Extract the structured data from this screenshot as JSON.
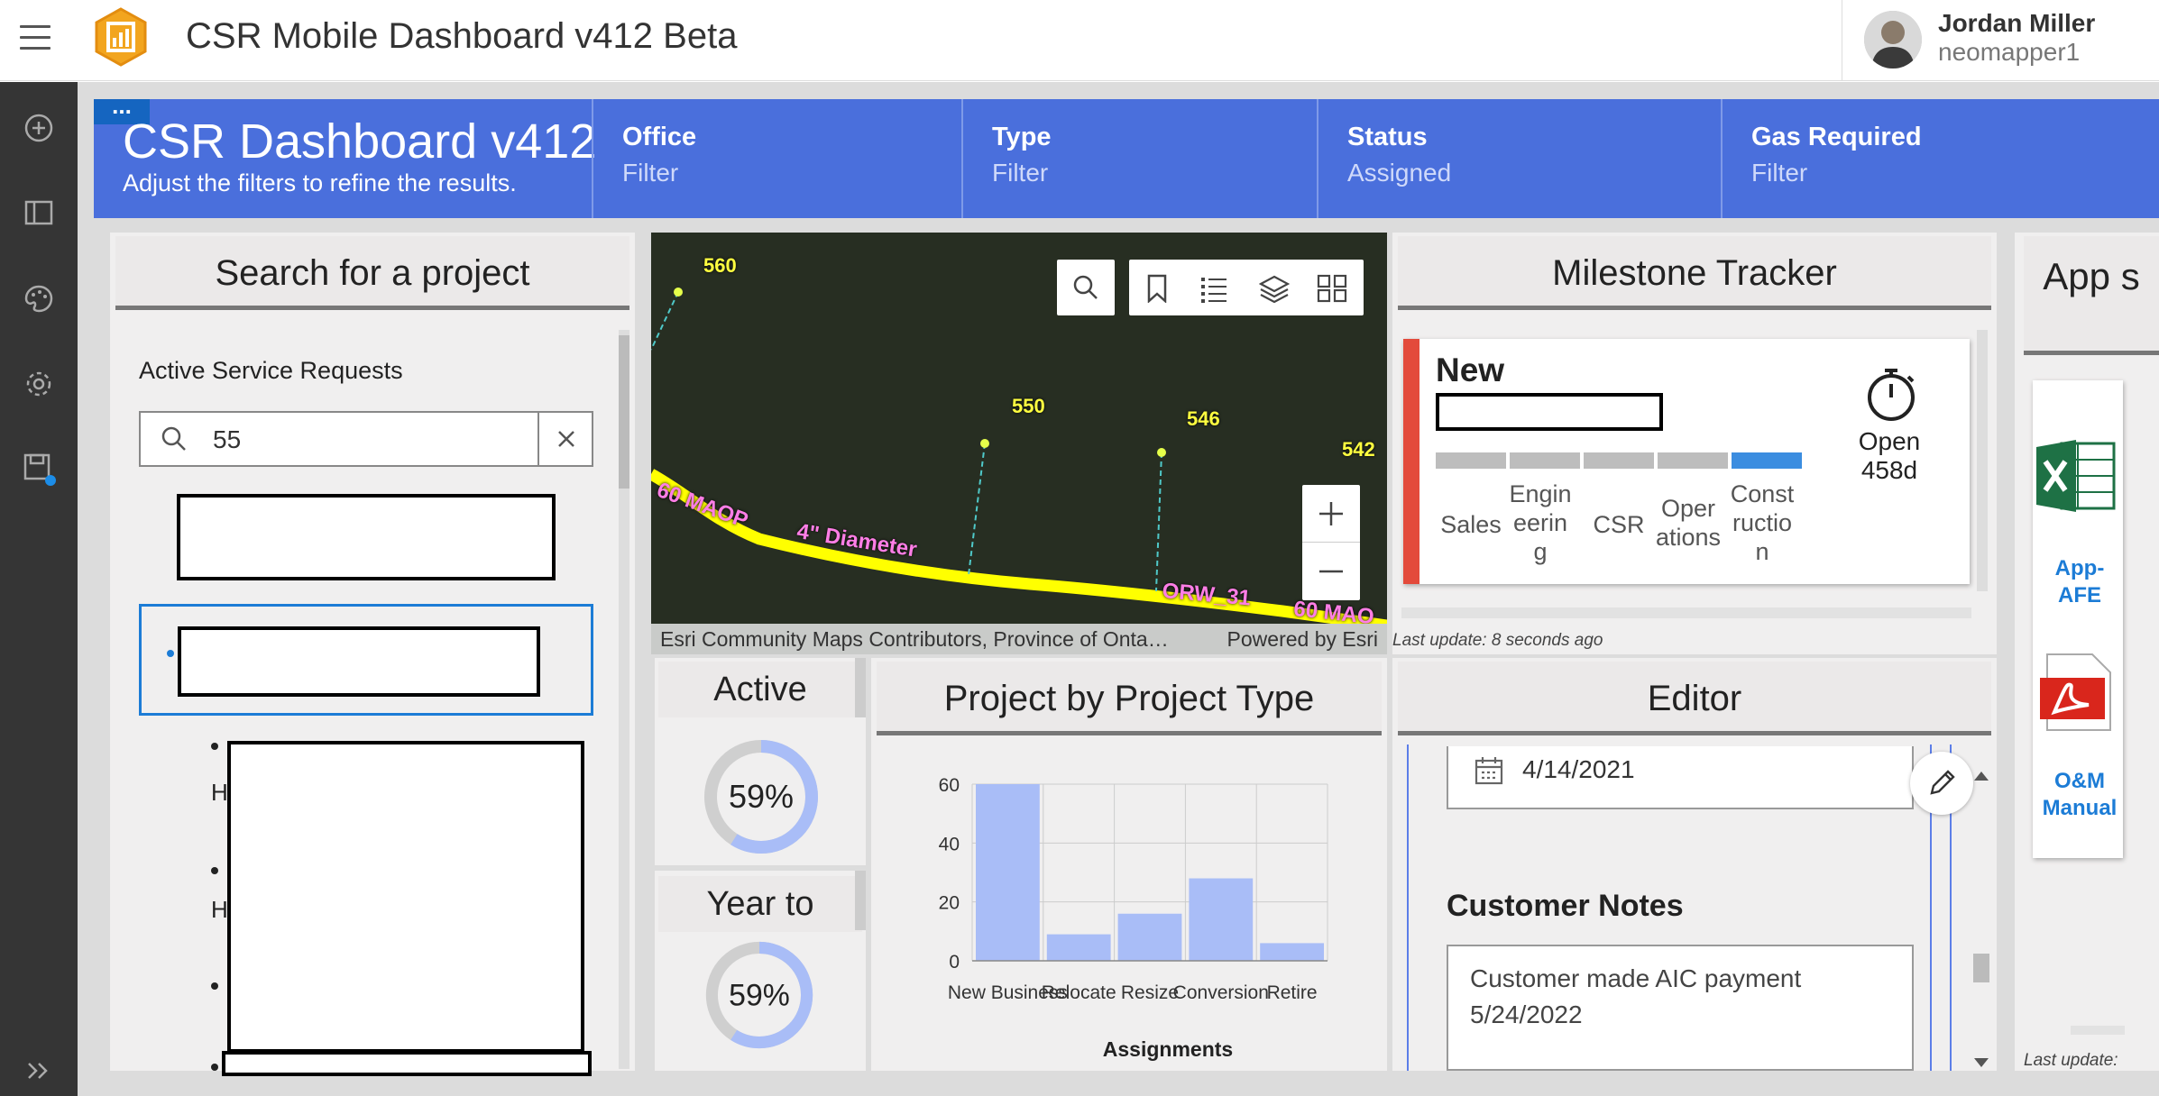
{
  "app": {
    "title": "CSR Mobile Dashboard v412 Beta",
    "user_name": "Jordan Miller",
    "user_id": "neomapper1"
  },
  "sidebar": {
    "icons": [
      "add-icon",
      "layout-icon",
      "theme-icon",
      "settings-icon",
      "save-icon"
    ],
    "expand_icon": "double-chevron-right-icon"
  },
  "header": {
    "title": "CSR Dashboard v412",
    "subtitle": "Adjust the filters to refine the results.",
    "filters": [
      {
        "label": "Office",
        "value": "Filter"
      },
      {
        "label": "Type",
        "value": "Filter"
      },
      {
        "label": "Status",
        "value": "Assigned"
      },
      {
        "label": "Gas Required",
        "value": "Filter"
      }
    ]
  },
  "search_panel": {
    "title": "Search for a project",
    "list_label": "Active Service Requests",
    "search_value": "55",
    "list_fragments": [
      "H",
      "H"
    ]
  },
  "map": {
    "points": [
      "560",
      "550",
      "546",
      "542"
    ],
    "line_labels": [
      "60 MAOP",
      "4\" Diameter",
      "ORW_31",
      "60 MAO"
    ],
    "attribution": "Esri Community Maps Contributors, Province of Onta…",
    "powered_by": "Powered by Esri"
  },
  "milestone": {
    "title": "Milestone Tracker",
    "status": "New",
    "stages": [
      "Sales",
      "Engin eerin g",
      "CSR",
      "Oper ations",
      "Const ructio n"
    ],
    "current_stage": "Const ructio n",
    "open_label": "Open",
    "open_days": "458d",
    "last_update": "Last update: 8 seconds ago"
  },
  "active_kpi": {
    "title": "Active",
    "percent": 59,
    "percent_label": "59%"
  },
  "ytd_kpi": {
    "title": "Year to",
    "percent": 59,
    "percent_label": "59%"
  },
  "project_chart": {
    "title": "Project by Project Type"
  },
  "chart_data": {
    "type": "bar",
    "categories": [
      "New Business",
      "Relocate",
      "Resize",
      "Conversion",
      "Retire"
    ],
    "values": [
      60,
      9,
      16,
      28,
      6
    ],
    "xlabel": "Assignments",
    "ylabel": "",
    "ylim": [
      0,
      60
    ],
    "yticks": [
      0,
      20,
      40,
      60
    ],
    "grid": true,
    "color": "#a9bdf7"
  },
  "editor": {
    "title": "Editor",
    "date_value": "4/14/2021",
    "notes_label": "Customer Notes",
    "notes_value": "Customer made AIC payment 5/24/2022"
  },
  "apps": {
    "title": "App s",
    "items": [
      {
        "label": "App-AFE",
        "icon": "excel-icon"
      },
      {
        "label": "O&M Manual",
        "icon": "pdf-icon"
      }
    ],
    "last_update": "Last update:"
  },
  "colors": {
    "header_blue": "#4a6fdc",
    "sidebar": "#353535",
    "status_bar_red": "#e34a3b",
    "stage_active": "#3b8de0",
    "stage_inactive": "#bdbdbd",
    "link_blue": "#1c7cd6",
    "map_line": "#ffff00",
    "map_label": "#ff7ee6"
  }
}
